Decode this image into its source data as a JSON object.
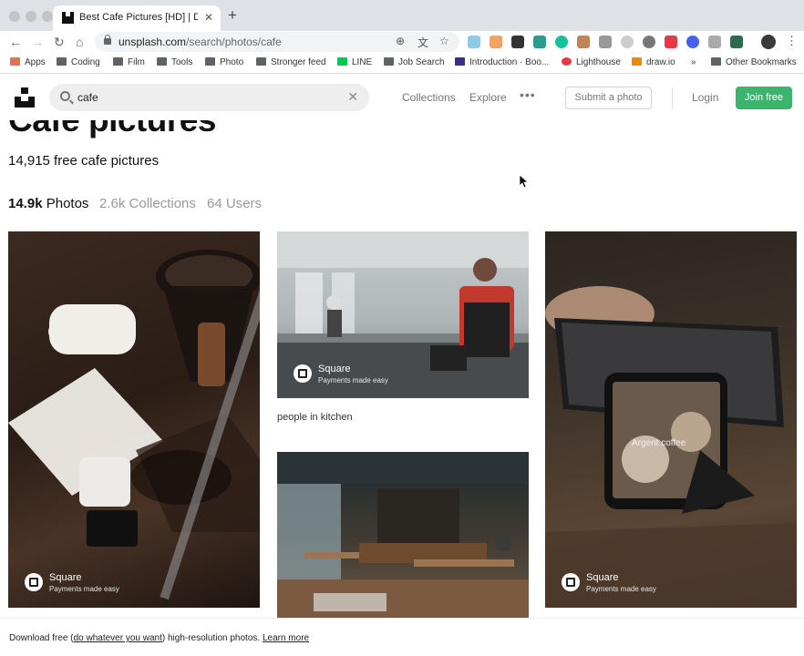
{
  "browser": {
    "tab_title": "Best Cafe Pictures [HD] | Download",
    "tab_close": "✕",
    "new_tab": "+",
    "url_host": "unsplash.com",
    "url_path": "/search/photos/cafe",
    "bookmarks": [
      {
        "label": "Apps",
        "icon": "apps-grid-icon"
      },
      {
        "label": "Coding",
        "icon": "folder-icon"
      },
      {
        "label": "Film",
        "icon": "folder-icon"
      },
      {
        "label": "Tools",
        "icon": "folder-icon"
      },
      {
        "label": "Photo",
        "icon": "folder-icon"
      },
      {
        "label": "Stronger feed",
        "icon": "folder-icon"
      },
      {
        "label": "LINE",
        "icon": "line-icon"
      },
      {
        "label": "Job Search",
        "icon": "folder-icon"
      },
      {
        "label": "Introduction · Boo...",
        "icon": "b-icon"
      },
      {
        "label": "Lighthouse",
        "icon": "lighthouse-icon"
      },
      {
        "label": "draw.io",
        "icon": "drawio-icon"
      },
      {
        "label": "»",
        "icon": ""
      },
      {
        "label": "Other Bookmarks",
        "icon": "folder-icon"
      }
    ]
  },
  "header": {
    "search_value": "cafe",
    "search_clear": "✕",
    "nav_collections": "Collections",
    "nav_explore": "Explore",
    "more": "•••",
    "submit_photo": "Submit a photo",
    "login": "Login",
    "join_free": "Join free"
  },
  "main": {
    "title": "Cafe pictures",
    "count": "14,915 free cafe pictures",
    "tabs": [
      {
        "count": "14.9k",
        "label": "Photos"
      },
      {
        "count": "2.6k",
        "label": "Collections"
      },
      {
        "count": "64",
        "label": "Users"
      }
    ],
    "photos": [
      {
        "sponsor_name": "Square",
        "sponsor_tag": "Payments made easy"
      },
      {
        "sponsor_name": "Square",
        "sponsor_tag": "Payments made easy",
        "caption": "people in kitchen"
      },
      {
        "sponsor_name": "",
        "sponsor_tag": ""
      },
      {
        "sponsor_name": "Square",
        "sponsor_tag": "Payments made easy",
        "overlay_text": "Argent coffee"
      }
    ]
  },
  "footer": {
    "prefix": "Download free (",
    "link1": "do whatever you want",
    "mid": ") high-resolution photos.",
    "link2": "Learn more"
  },
  "colors": {
    "join_green": "#3cb46e",
    "muted": "#767676"
  }
}
